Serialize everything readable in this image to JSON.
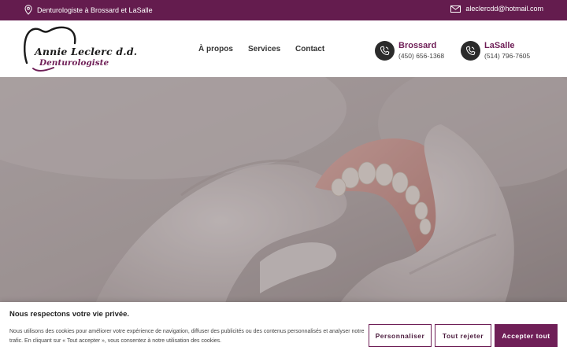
{
  "topbar": {
    "location_text": "Denturologiste à Brossard et LaSalle",
    "email": "aleclercdd@hotmail.com",
    "location_icon": "map-pin-icon",
    "email_icon": "envelope-icon"
  },
  "logo": {
    "line1": "Annie Leclerc d.d.",
    "line2": "Denturologiste",
    "icon": "tooth-logo-icon"
  },
  "nav": {
    "items": [
      "À propos",
      "Services",
      "Contact"
    ]
  },
  "phones": [
    {
      "city": "Brossard",
      "number": "(450) 656-1368",
      "icon": "phone-icon"
    },
    {
      "city": "LaSalle",
      "number": "(514) 796-7605",
      "icon": "phone-icon"
    }
  ],
  "cookie": {
    "title": "Nous respectons votre vie privée.",
    "description": "Nous utilisons des cookies pour améliorer votre expérience de navigation, diffuser des publicités ou des contenus personnalisés et analyser notre trafic. En cliquant sur « Tout accepter », vous consentez à notre utilisation des cookies.",
    "customize_label": "Personnaliser",
    "reject_label": "Tout rejeter",
    "accept_label": "Accepter tout"
  },
  "colors": {
    "brand": "#641c4e",
    "accent": "#6f1f57",
    "dark": "#2b2b2b"
  }
}
